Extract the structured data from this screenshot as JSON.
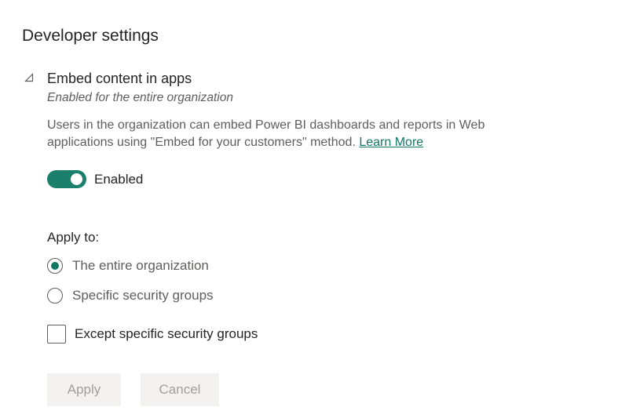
{
  "page": {
    "title": "Developer settings"
  },
  "setting": {
    "title": "Embed content in apps",
    "subtitle": "Enabled for the entire organization",
    "description": "Users in the organization can embed Power BI dashboards and reports in Web applications using \"Embed for your customers\" method.",
    "learn_more": "Learn More",
    "toggle": {
      "state": "on",
      "label": "Enabled"
    },
    "apply_to": {
      "label": "Apply to:",
      "options": [
        {
          "label": "The entire organization",
          "selected": true
        },
        {
          "label": "Specific security groups",
          "selected": false
        }
      ]
    },
    "except": {
      "label": "Except specific security groups",
      "checked": false
    }
  },
  "buttons": {
    "apply": "Apply",
    "cancel": "Cancel"
  },
  "colors": {
    "accent": "#117865",
    "toggle_on": "#1a7f6b",
    "disabled_button_bg": "#f3f2f1",
    "disabled_button_text": "#a19f9d"
  },
  "icons": {
    "collapse": "collapse-triangle-icon"
  }
}
